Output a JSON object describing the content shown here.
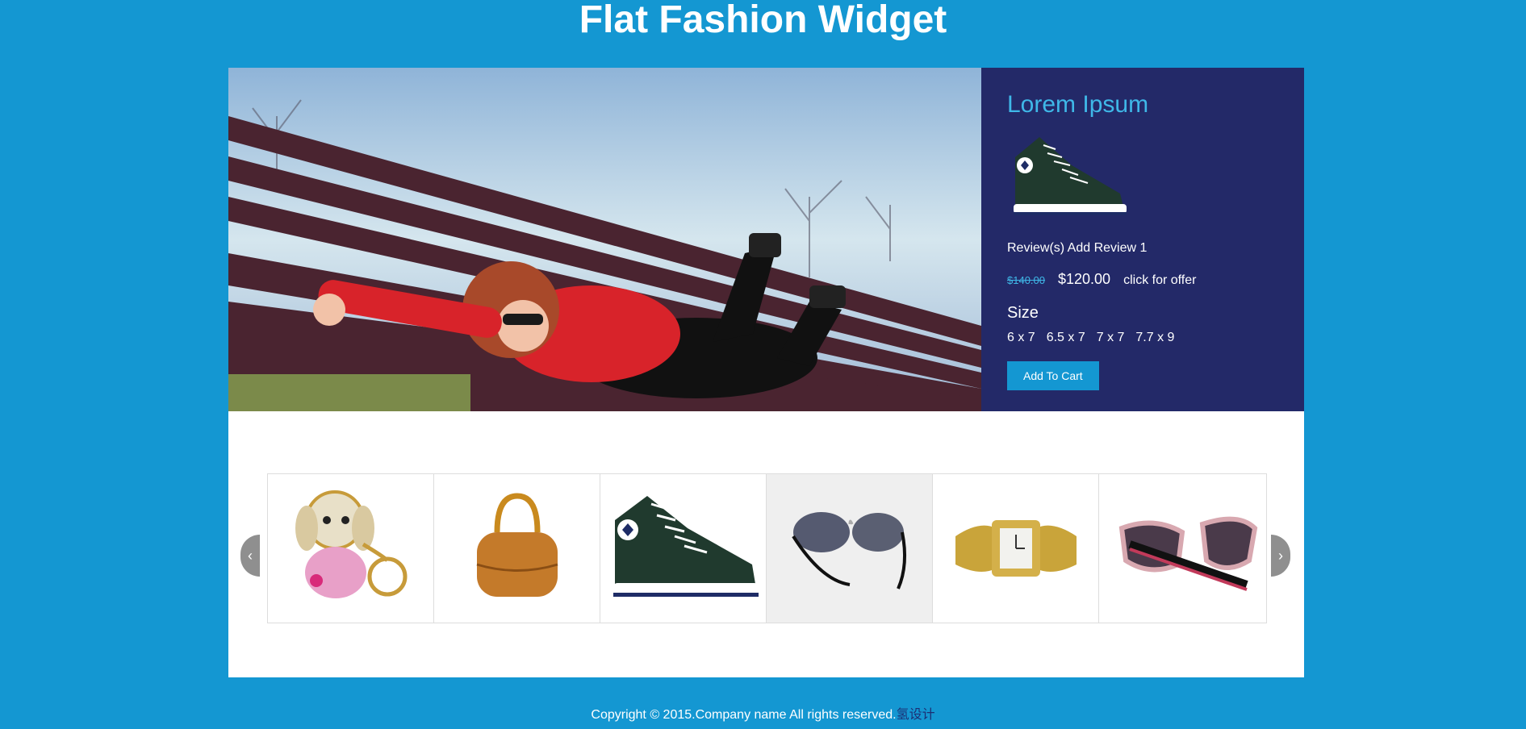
{
  "header": {
    "title": "Flat Fashion Widget"
  },
  "product": {
    "name": "Lorem Ipsum",
    "reviews_text": "Review(s) Add Review 1",
    "old_price": "$140.00",
    "new_price": "$120.00",
    "offer_text": "click for offer",
    "size_label": "Size",
    "sizes": [
      "6 x 7",
      "6.5 x 7",
      "7 x 7",
      "7.7 x 9"
    ],
    "cart_button": "Add To Cart"
  },
  "carousel": {
    "prev_arrow": "‹",
    "next_arrow": "›",
    "items": [
      {
        "name": "dog-keychain-image"
      },
      {
        "name": "handbag-image"
      },
      {
        "name": "sneaker-image"
      },
      {
        "name": "sunglasses-aviator-image"
      },
      {
        "name": "gold-watch-image"
      },
      {
        "name": "cat-eye-sunglasses-image"
      }
    ]
  },
  "footer": {
    "copyright": "Copyright © 2015.Company name All rights reserved.",
    "link": "氢设计"
  },
  "colors": {
    "background": "#1497d2",
    "panel": "#232968",
    "accent": "#3fb8e8"
  }
}
